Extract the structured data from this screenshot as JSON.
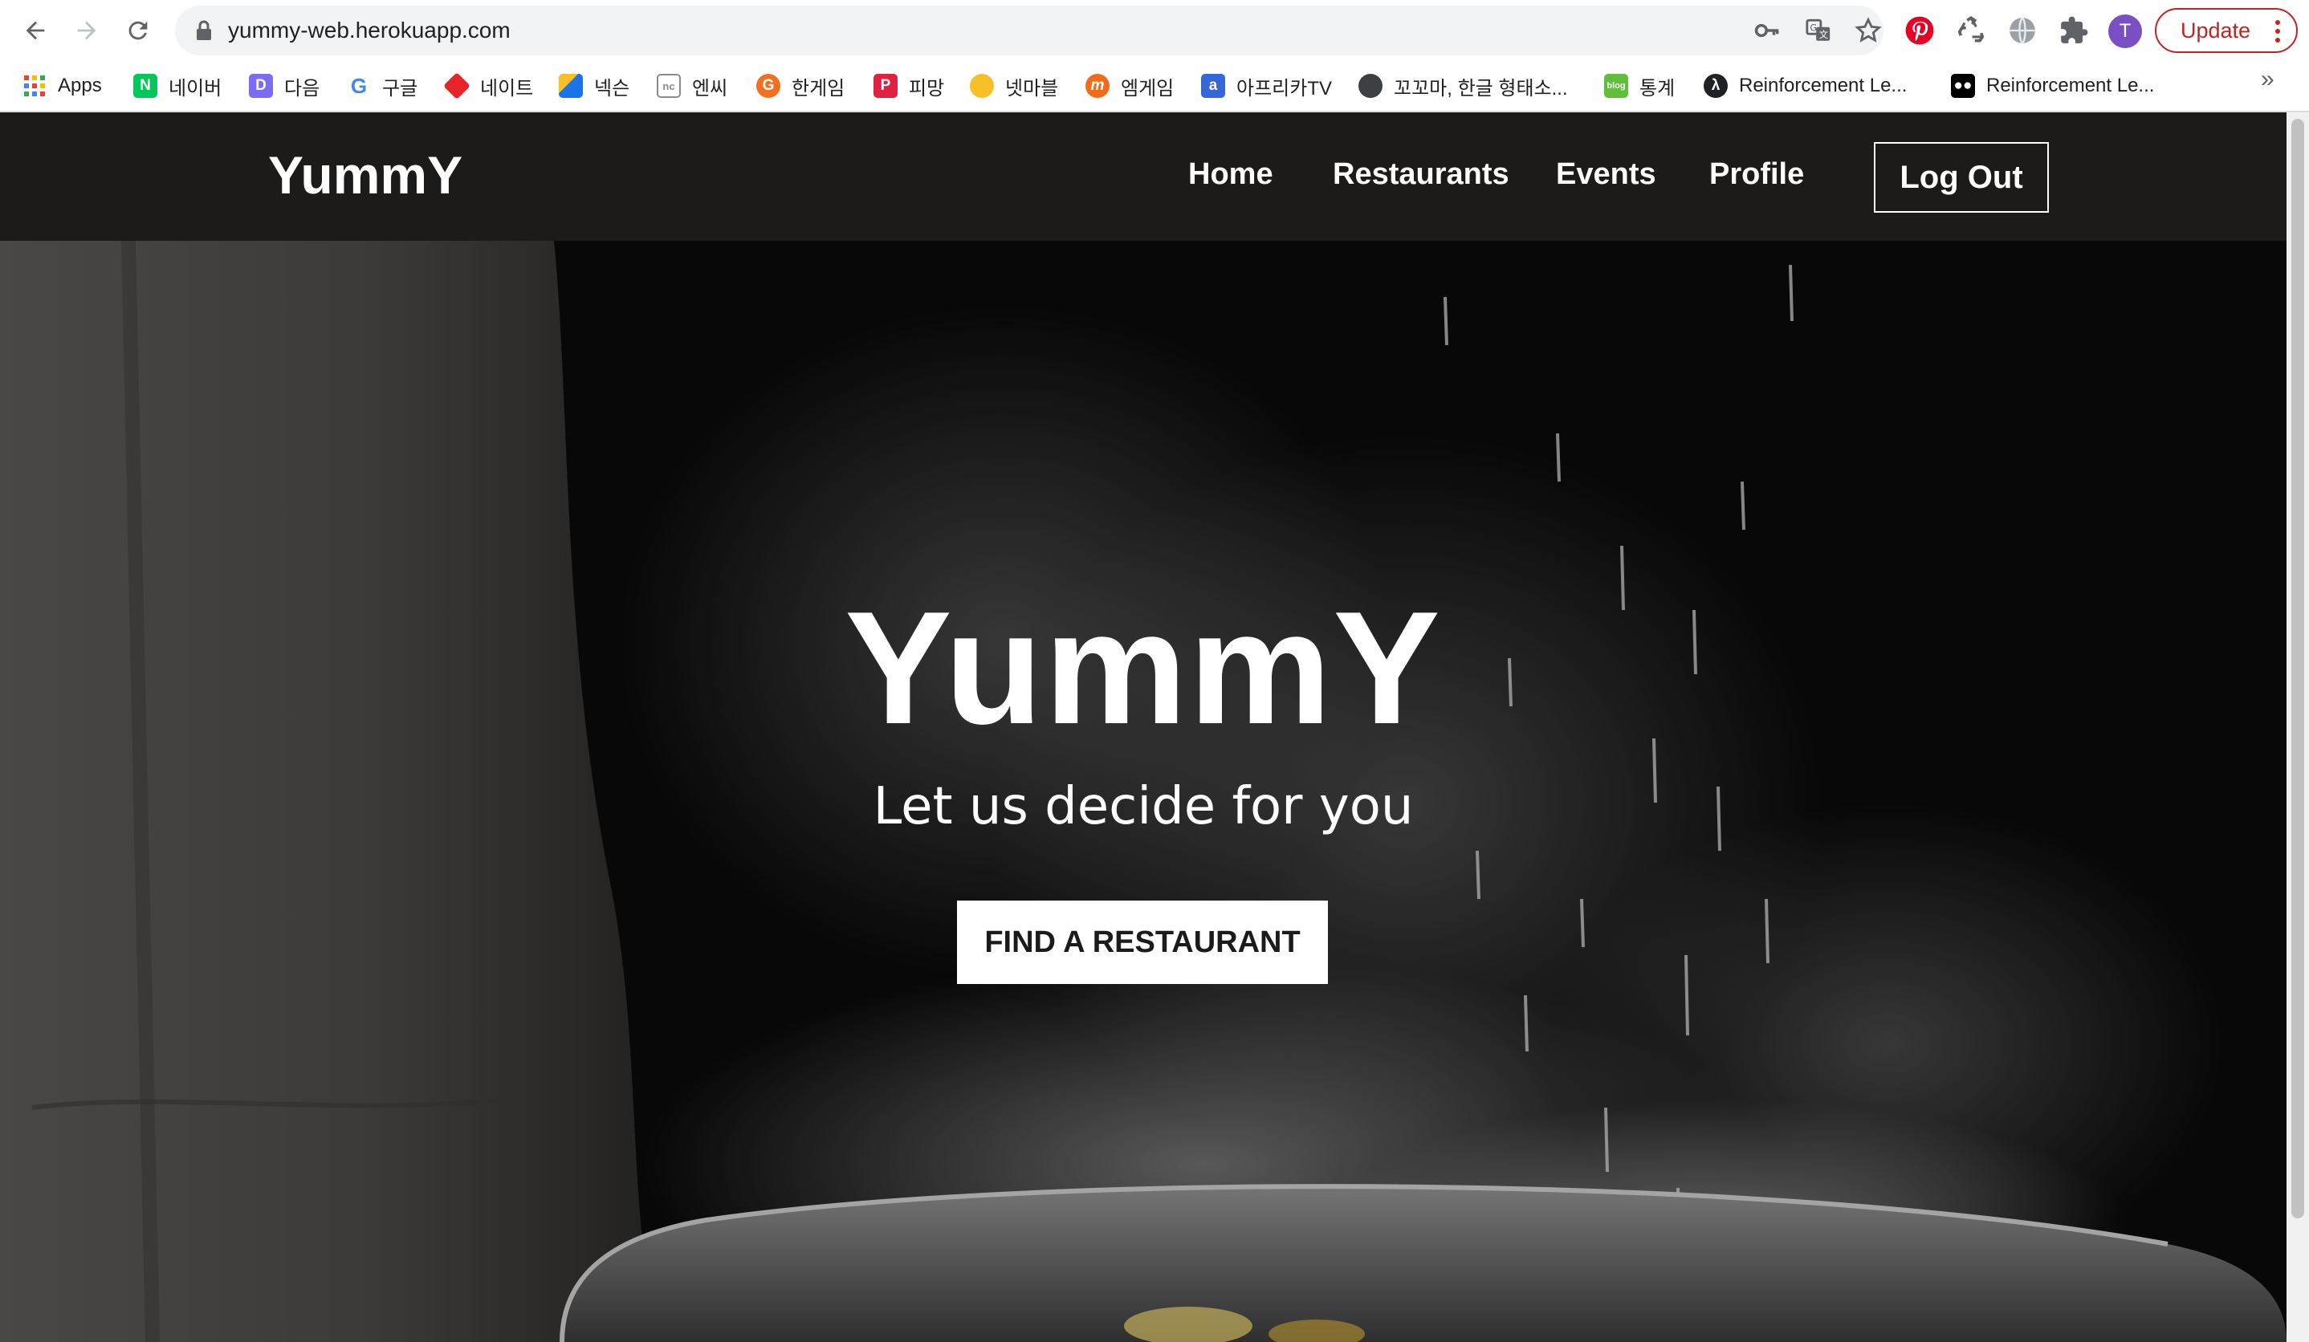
{
  "browser": {
    "url": "yummy-web.herokuapp.com",
    "profile_initial": "T",
    "update_label": "Update",
    "bookmarks": [
      {
        "label": "Apps",
        "icon": "apps-grid-icon",
        "color": "#ea4335"
      },
      {
        "label": "네이버",
        "icon": "naver-icon",
        "color": "#03c75a"
      },
      {
        "label": "다음",
        "icon": "daum-icon",
        "color": "#7a6cf5"
      },
      {
        "label": "구글",
        "icon": "google-icon",
        "color": "#4285f4"
      },
      {
        "label": "네이트",
        "icon": "nate-icon",
        "color": "#e8242b"
      },
      {
        "label": "넥슨",
        "icon": "nexon-icon",
        "color": "#1a73e8"
      },
      {
        "label": "엔씨",
        "icon": "ncsoft-icon",
        "color": "#8a8a8a"
      },
      {
        "label": "한게임",
        "icon": "hangame-icon",
        "color": "#f37021"
      },
      {
        "label": "피망",
        "icon": "pmang-icon",
        "color": "#e02141"
      },
      {
        "label": "넷마블",
        "icon": "netmarble-icon",
        "color": "#f6c026"
      },
      {
        "label": "엠게임",
        "icon": "mgame-icon",
        "color": "#ef6c1a"
      },
      {
        "label": "아프리카TV",
        "icon": "afreecatv-icon",
        "color": "#3567d6"
      },
      {
        "label": "꼬꼬마, 한글 형태소...",
        "icon": "globe-icon",
        "color": "#3c4043"
      },
      {
        "label": "통계",
        "icon": "stats-icon",
        "color": "#5fbf3a"
      },
      {
        "label": "Reinforcement Le...",
        "icon": "lambda-icon",
        "color": "#202124"
      },
      {
        "label": "Reinforcement Le...",
        "icon": "medium-icon",
        "color": "#000000"
      }
    ]
  },
  "site": {
    "brand": "YummY",
    "nav": [
      "Home",
      "Restaurants",
      "Events",
      "Profile"
    ],
    "logout_label": "Log Out"
  },
  "hero": {
    "title": "YummY",
    "subtitle": "Let us decide for you",
    "cta_label": "FIND A RESTAURANT"
  }
}
